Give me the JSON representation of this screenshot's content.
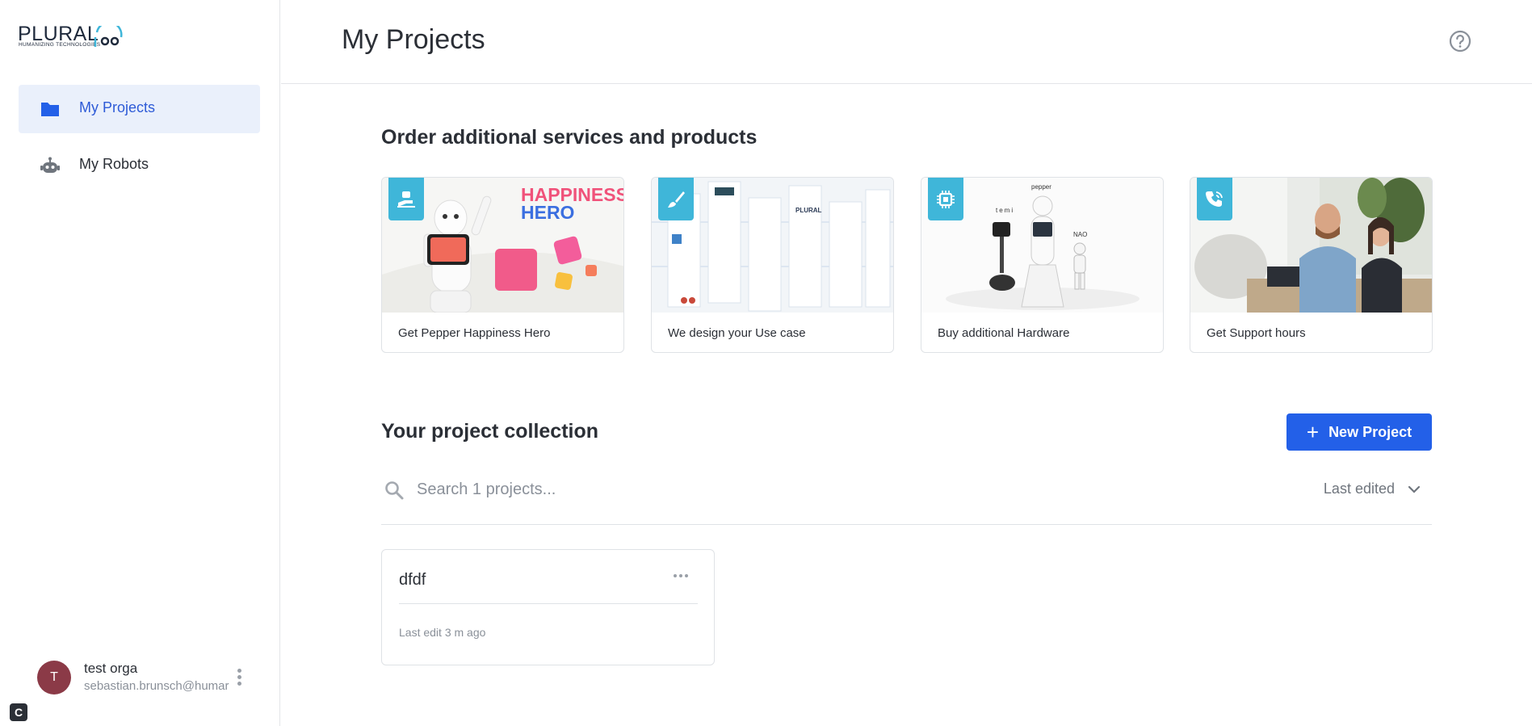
{
  "brand": {
    "logo_text": "PLURAL",
    "logo_sub": "HUMANIZING TECHNOLOGIES"
  },
  "sidebar": {
    "items": [
      {
        "label": "My Projects",
        "icon": "folder-icon",
        "active": true
      },
      {
        "label": "My Robots",
        "icon": "robot-icon",
        "active": false
      }
    ]
  },
  "user": {
    "initial": "T",
    "name": "test orga",
    "email": "sebastian.brunsch@humar"
  },
  "corner_badge": "C",
  "header": {
    "title": "My Projects",
    "help_icon": "help-circle-icon"
  },
  "services": {
    "title": "Order additional services and products",
    "cards": [
      {
        "label": "Get Pepper Happiness Hero",
        "icon": "hand-robot-icon",
        "image_text": [
          "HAPPINESS",
          "HERO"
        ]
      },
      {
        "label": "We design your Use case",
        "icon": "brush-icon",
        "image_text": [
          "PLURAL"
        ]
      },
      {
        "label": "Buy additional Hardware",
        "icon": "chip-icon",
        "image_text": [
          "pepper",
          "temi",
          "NAO"
        ]
      },
      {
        "label": "Get Support hours",
        "icon": "phone-icon",
        "image_text": []
      }
    ]
  },
  "collection": {
    "title": "Your project collection",
    "new_button": "New Project",
    "search_placeholder": "Search 1 projects...",
    "sort_label": "Last edited",
    "projects": [
      {
        "name": "dfdf",
        "meta": "Last edit 3 m ago"
      }
    ]
  },
  "colors": {
    "accent": "#2360e8",
    "active_bg": "#eaf0fb",
    "badge": "#3fb6d9",
    "avatar": "#8b3a47"
  }
}
